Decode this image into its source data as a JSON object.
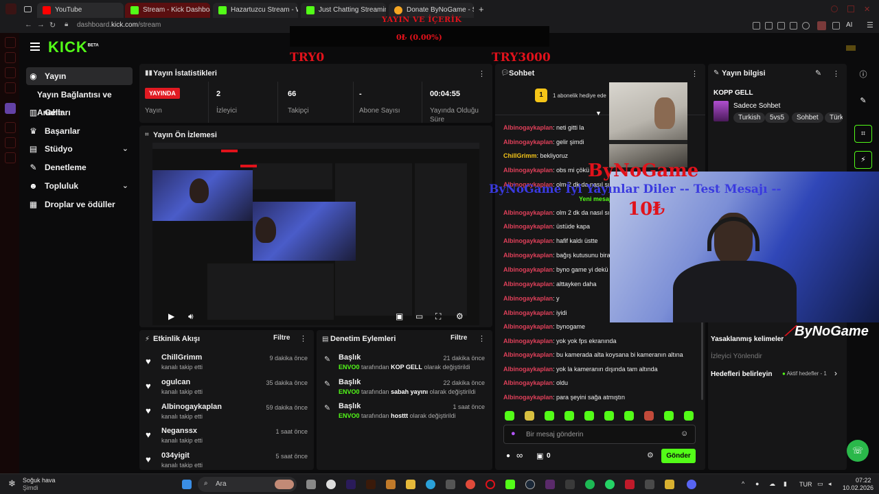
{
  "browser": {
    "tabs": [
      {
        "label": "YouTube",
        "color": "#ff0000"
      },
      {
        "label": "Stream - Kick Dashboard",
        "color": "#53fc18"
      },
      {
        "label": "Hazartuzcu Stream - Watc",
        "color": "#53fc18"
      },
      {
        "label": "Just Chatting Streaming -",
        "color": "#53fc18"
      },
      {
        "label": "Donate ByNoGame - Strea",
        "color": "#f5a623"
      }
    ],
    "url_prefix": "dashboard.",
    "url_domain": "kick.com",
    "url_path": "/stream",
    "add_tab": "+",
    "profile_label": "AI"
  },
  "overlay": {
    "goal_title": "YAYIN VE İÇERİK",
    "goal_value": "0₺ (0.00%)",
    "goal_min": "TRY0",
    "goal_max": "TRY3000",
    "donor": "ByNoGame",
    "donation_message": "ByNoGame İyi Yayınlar Diler -- Test Mesajı --",
    "donation_amount": "10₺",
    "brand": "ByNoGame"
  },
  "logo": {
    "text": "KICK",
    "tag": "BETA"
  },
  "sidebar": {
    "items": [
      {
        "label": "Yayın",
        "icon": "broadcast-icon"
      },
      {
        "label": "Yayın Bağlantısı ve Anahtarı",
        "icon": ""
      },
      {
        "label": "Gelir",
        "icon": "chart-icon"
      },
      {
        "label": "Başarılar",
        "icon": "trophy-icon"
      },
      {
        "label": "Stüdyo",
        "icon": "studio-icon"
      },
      {
        "label": "Denetleme",
        "icon": "wrench-icon"
      },
      {
        "label": "Topluluk",
        "icon": "people-icon"
      },
      {
        "label": "Droplar ve ödüller",
        "icon": "drops-icon"
      }
    ]
  },
  "stats": {
    "title": "Yayın İstatistikleri",
    "live_badge": "YAYINDA",
    "live_label": "Yayın",
    "viewers_value": "2",
    "viewers_label": "İzleyici",
    "followers_value": "66",
    "followers_label": "Takipçi",
    "subs_value": "-",
    "subs_label": "Abone Sayısı",
    "uptime_value": "00:04:55",
    "uptime_label": "Yayında Olduğu Süre"
  },
  "preview": {
    "title": "Yayın Ön İzlemesi"
  },
  "activity": {
    "title": "Etkinlik Akışı",
    "filter": "Filtre",
    "items": [
      {
        "name": "ChillGrimm",
        "sub": "kanalı takip etti",
        "time": "9 dakika önce"
      },
      {
        "name": "ogulcan",
        "sub": "kanalı takip etti",
        "time": "35 dakika önce"
      },
      {
        "name": "Albinogaykaplan",
        "sub": "kanalı takip etti",
        "time": "59 dakika önce"
      },
      {
        "name": "Neganssx",
        "sub": "kanalı takip etti",
        "time": "1 saat önce"
      },
      {
        "name": "034yigit",
        "sub": "kanalı takip etti",
        "time": "5 saat önce"
      }
    ]
  },
  "moderation": {
    "title": "Denetim Eylemleri",
    "filter": "Filtre",
    "items": [
      {
        "title": "Başlık",
        "actor": "ENVO0",
        "mid": "tarafından",
        "value": "KOP GELL",
        "tail": "olarak değiştirildi",
        "time": "21 dakika önce"
      },
      {
        "title": "Başlık",
        "actor": "ENVO0",
        "mid": "tarafından",
        "value": "sabah yayını",
        "tail": "olarak değiştirildi",
        "time": "22 dakika önce"
      },
      {
        "title": "Başlık",
        "actor": "ENVO0",
        "mid": "tarafından",
        "value": "hosttt",
        "tail": "olarak değiştirildi",
        "time": "1 saat önce"
      }
    ]
  },
  "chat": {
    "title": "Sohbet",
    "sub_gift": "1 abonelik hediye ede",
    "new_messages": "Yeni mesaj",
    "messages": [
      {
        "user": "Albinogaykaplan",
        "text": ": neti gitti la"
      },
      {
        "user": "Albinogaykaplan",
        "text": ": gelir şimdi"
      },
      {
        "user": "ChillGrimm",
        "text": ": bekliyoruz"
      },
      {
        "user": "Albinogaykaplan",
        "text": ": obs mi çökü"
      },
      {
        "user": "Albinogaykaplan",
        "text": ": olm 2 dk da nasıl sı"
      },
      {
        "user": "Albinogaykaplan",
        "text": ": olm 2 dk da nasıl sı"
      },
      {
        "user": "Albinogaykaplan",
        "text": ": üstüde kapa"
      },
      {
        "user": "Albinogaykaplan",
        "text": ": hafif kaldı üstte"
      },
      {
        "user": "Albinogaykaplan",
        "text": ": bağış kutusunu bira"
      },
      {
        "user": "Albinogaykaplan",
        "text": ": byno game yi dekü"
      },
      {
        "user": "Albinogaykaplan",
        "text": ": alttayken daha"
      },
      {
        "user": "Albinogaykaplan",
        "text": ": y"
      },
      {
        "user": "Albinogaykaplan",
        "text": ": iyidi"
      },
      {
        "user": "Albinogaykaplan",
        "text": ": bynogame"
      },
      {
        "user": "Albinogaykaplan",
        "text": ": yok yok fps ekranında"
      },
      {
        "user": "Albinogaykaplan",
        "text": ": bu kamerada alta koysana bi kameranın altına"
      },
      {
        "user": "Albinogaykaplan",
        "text": ": yok la kameranın dışında tam altında"
      },
      {
        "user": "Albinogaykaplan",
        "text": ": oldu"
      },
      {
        "user": "Albinogaykaplan",
        "text": ": para şeyini sağa atmıştın"
      }
    ],
    "input_placeholder": "Bir mesaj gönderin",
    "points_value": "0",
    "send_label": "Gönder",
    "infinity": "∞"
  },
  "stream_info": {
    "title": "Yayın bilgisi",
    "stream_title": "KOPP GELL",
    "category": "Sadece Sohbet",
    "tags": [
      "Turkish",
      "5vs5",
      "Sohbet",
      "Türk"
    ],
    "banned_words": "Yasaklanmış kelimeler",
    "viewer_redirect": "İzleyici Yönlendir",
    "goals_label": "Hedefleri belirleyin",
    "goals_status": "Aktif hedefler - 1"
  },
  "taskbar": {
    "weather_title": "Soğuk hava",
    "weather_sub": "Şimdi",
    "search": "Ara",
    "lang": "TUR",
    "time": "07:22",
    "date": "10.02.2026"
  },
  "colors": {
    "kick_green": "#53fc18",
    "live_red": "#e11a22",
    "chat_user": "#e0405a",
    "overlay_red": "#e0121b"
  }
}
